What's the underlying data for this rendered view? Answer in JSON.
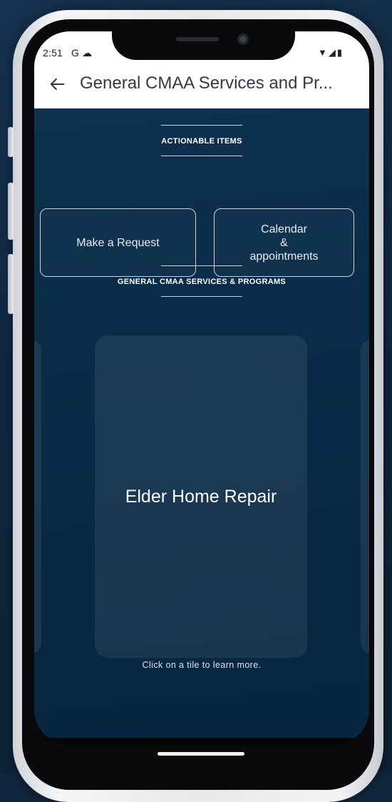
{
  "status_bar": {
    "time": "2:51",
    "left_icons": "G ☁",
    "right_icons": "▼◢▮"
  },
  "app_bar": {
    "back_icon": "arrow-left-icon",
    "title": "General CMAA Services and Pr..."
  },
  "actionable": {
    "header": "ACTIONABLE ITEMS",
    "buttons": [
      {
        "label": "Make a Request"
      },
      {
        "line1": "Calendar",
        "line2": "&",
        "line3": "appointments"
      }
    ]
  },
  "services": {
    "header": "GENERAL CMAA SERVICES & PROGRAMS",
    "tiles": [
      {
        "label": "Elder Home Repair"
      }
    ],
    "hint": "Click on a tile to learn more."
  },
  "colors": {
    "screen_bg": "#0a2c48",
    "header_bg": "#ffffff",
    "accent_border": "#c9d3dc"
  }
}
